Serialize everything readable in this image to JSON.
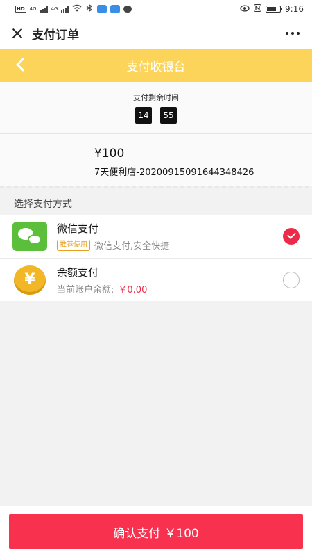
{
  "status_bar": {
    "time": "9:16",
    "network_labels": [
      "4G",
      "4G"
    ],
    "hd_labels": [
      "HD",
      "HD"
    ]
  },
  "title_bar": {
    "title": "支付订单",
    "close_icon": "close-icon",
    "more_icon": "more-horizontal-icon"
  },
  "cashier": {
    "title": "支付收银台",
    "back_icon": "chevron-left-icon",
    "header_color": "#fcd45a"
  },
  "timer": {
    "label": "支付剩余时间",
    "minutes": "14",
    "seconds": "55"
  },
  "order": {
    "amount": "¥100",
    "order_id": "7天便利店-20200915091644348426"
  },
  "pay_methods": {
    "section_label": "选择支付方式",
    "items": [
      {
        "name": "微信支付",
        "tag": "推荐使用",
        "description": "微信支付,安全快捷",
        "icon": "wechat-icon",
        "selected": true
      },
      {
        "name": "余额支付",
        "description": "当前账户余额:",
        "balance": "￥0.00",
        "icon": "yuan-coin-icon",
        "selected": false
      }
    ]
  },
  "confirm": {
    "label": "确认支付",
    "amount": "￥100",
    "color": "#f8324e"
  }
}
